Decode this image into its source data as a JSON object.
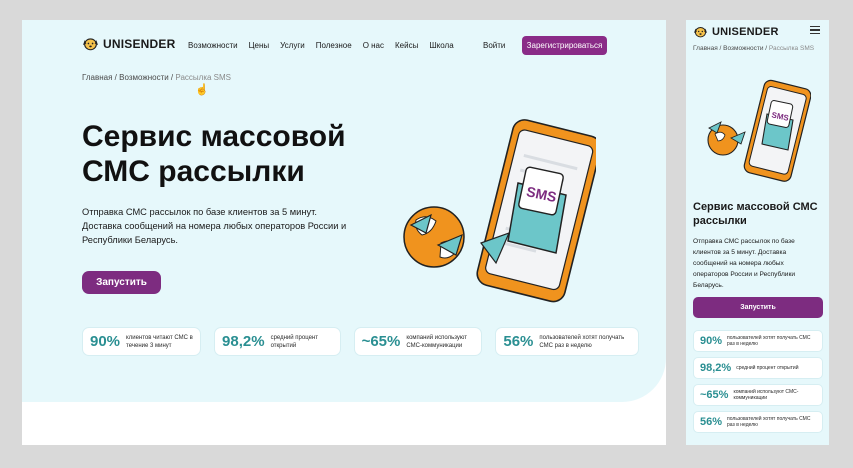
{
  "brand": {
    "name": "UNISENDER"
  },
  "nav": {
    "items": [
      "Возможности",
      "Цены",
      "Услуги",
      "Полезное",
      "О нас",
      "Кейсы",
      "Школа"
    ],
    "login": "Войти",
    "register": "Зарегистрироваться"
  },
  "breadcrumb": {
    "home": "Главная",
    "sep1": " / ",
    "features": "Возможности",
    "sep2": " / ",
    "current": "Рассылка SMS"
  },
  "hero": {
    "title": "Сервис массовой СМС рассылки",
    "lead": "Отправка СМС рассылок по базе клиентов за 5 минут. Доставка сообщений на номера любых операторов России и Республики Беларусь.",
    "cta": "Запустить"
  },
  "illustration": {
    "bubble_text": "SMS"
  },
  "stats": [
    {
      "value": "90%",
      "text": "клиентов читают СМС в течение 3 минут"
    },
    {
      "value": "98,2%",
      "text": "средний процент открытий"
    },
    {
      "value": "~65%",
      "text": "компаний используют СМС-коммуникации"
    },
    {
      "value": "56%",
      "text": "пользователей хотят получать СМС раз в неделю"
    }
  ],
  "mobile": {
    "title": "Сервис массовой СМС рассылки",
    "stats": [
      {
        "value": "90%",
        "text": "пользователей хотят получать СМС раз в неделю"
      },
      {
        "value": "98,2%",
        "text": "средний процент открытий"
      },
      {
        "value": "~65%",
        "text": "компаний используют СМС-коммуникации"
      },
      {
        "value": "56%",
        "text": "пользователей хотят получать СМС раз в неделю"
      }
    ]
  },
  "colors": {
    "accent": "#7d2c80",
    "hero_bg": "#e6f8fb",
    "stat_value": "#2a8f92",
    "phone_orange": "#f0931e",
    "envelope_teal": "#6cc6c9"
  }
}
